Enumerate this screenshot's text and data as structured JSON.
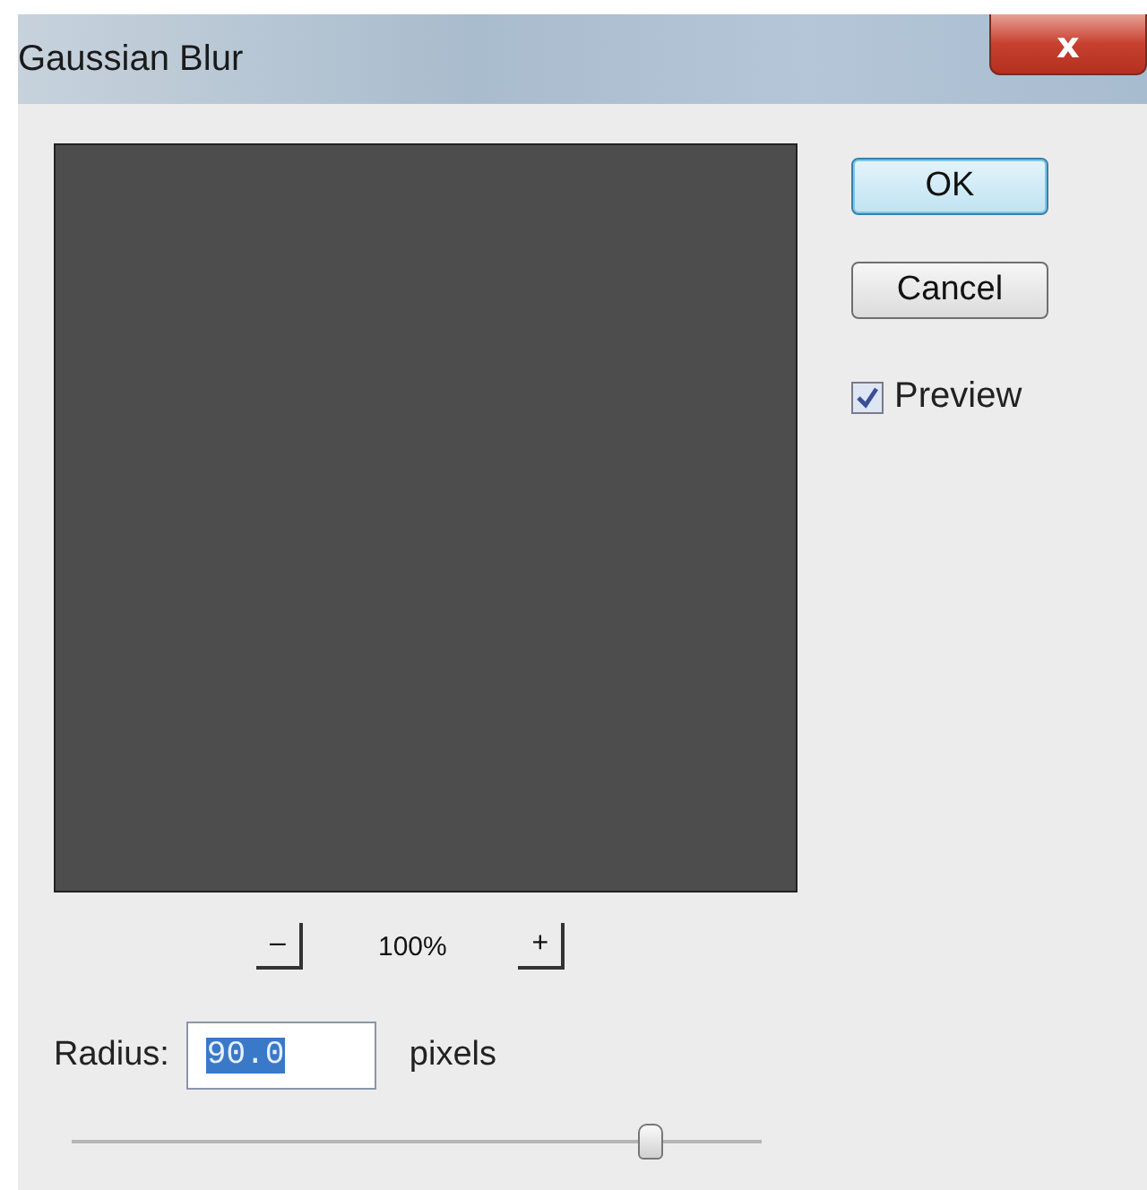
{
  "window": {
    "title": "Gaussian Blur",
    "close": "x"
  },
  "buttons": [
    {
      "label": "OK",
      "kind": "default"
    },
    {
      "label": "Cancel",
      "kind": "normal"
    }
  ],
  "preview_checkbox": {
    "label": "Preview",
    "checked": true
  },
  "zoom": {
    "minus": "–",
    "level_text": "100%",
    "plus": "+"
  },
  "radius": {
    "label": "Radius:",
    "value": "90.0",
    "unit": "pixels"
  },
  "slider": {
    "level": 0.84
  }
}
